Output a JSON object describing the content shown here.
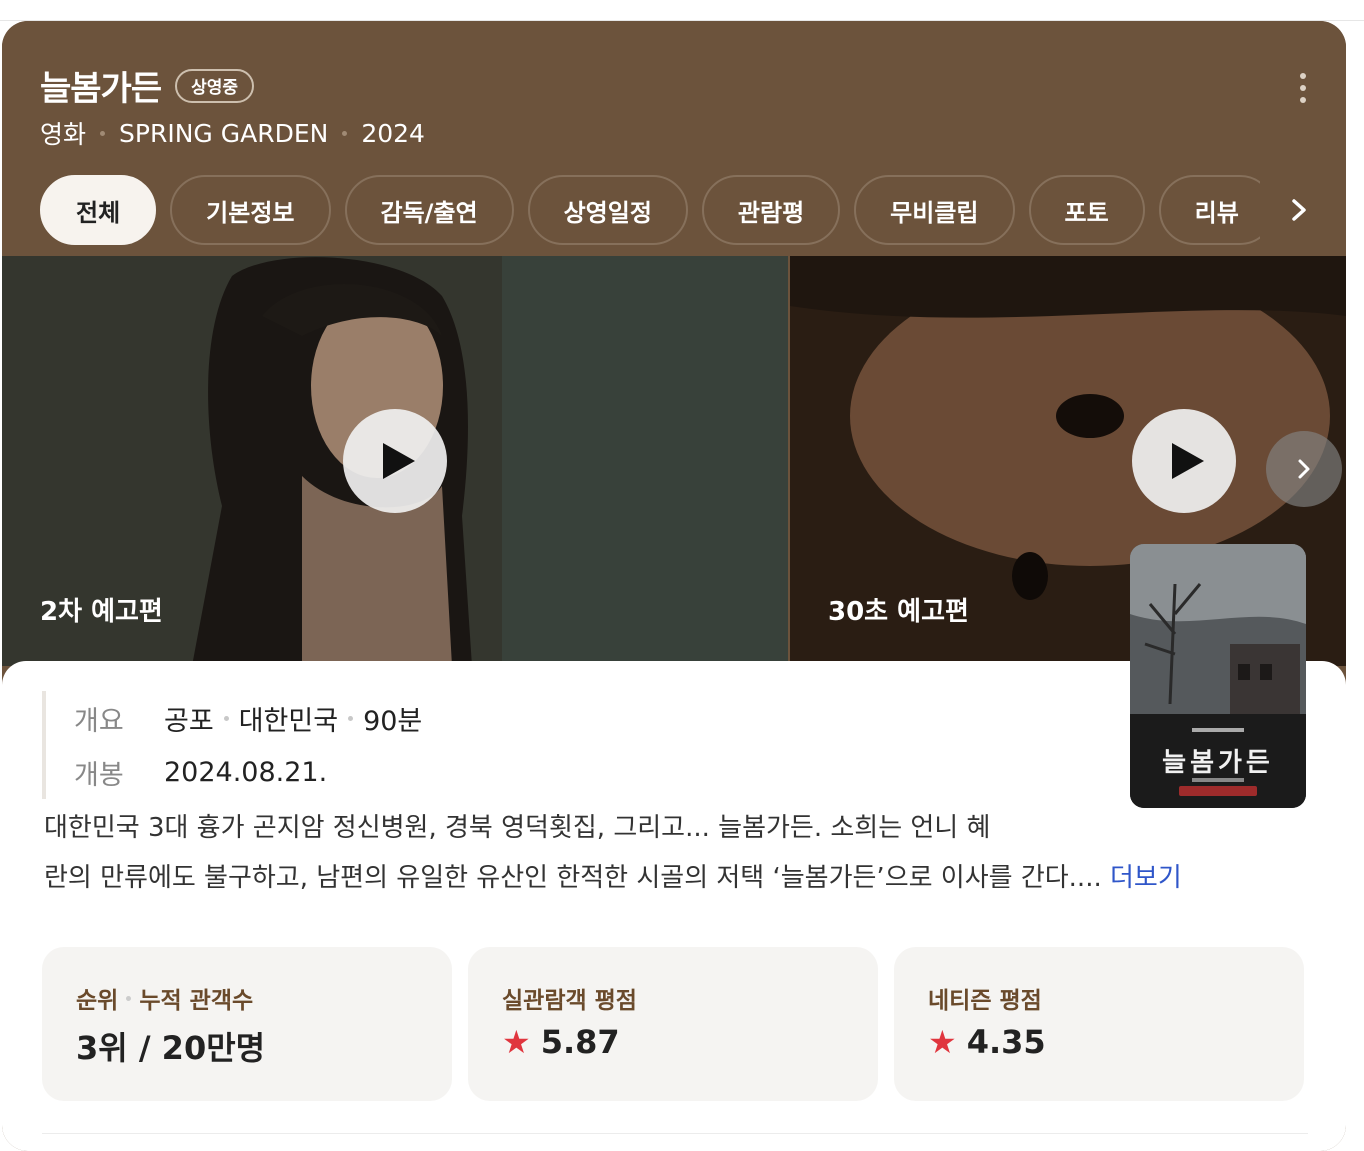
{
  "header": {
    "title": "늘봄가든",
    "badge": "상영중",
    "meta": [
      "영화",
      "SPRING GARDEN",
      "2024"
    ]
  },
  "tabs": [
    {
      "label": "전체",
      "active": true
    },
    {
      "label": "기본정보"
    },
    {
      "label": "감독/출연"
    },
    {
      "label": "상영일정"
    },
    {
      "label": "관람평"
    },
    {
      "label": "무비클립"
    },
    {
      "label": "포토"
    },
    {
      "label": "리뷰"
    }
  ],
  "videos": [
    {
      "label": "2차 예고편"
    },
    {
      "label": "30초 예고편"
    }
  ],
  "facts": {
    "overview_key": "개요",
    "genre": "공포",
    "country": "대한민국",
    "runtime": "90분",
    "release_key": "개봉",
    "release_date": "2024.08.21."
  },
  "synopsis": {
    "line1": "대한민국 3대 흉가 곤지암 정신병원, 경북 영덕횟집, 그리고... 늘봄가든. 소희는 언니 혜",
    "line2": "란의 만류에도 불구하고, 남편의 유일한 유산인 한적한 시골의 저택 ‘늘봄가든’으로 이사를 간다....",
    "more": "더보기"
  },
  "poster": {
    "title": "늘봄가든"
  },
  "stats": {
    "rank": {
      "label_a": "순위",
      "label_b": "누적 관객수",
      "value": "3위 / 20만명"
    },
    "audience": {
      "label": "실관람객 평점",
      "value": "5.87"
    },
    "netizen": {
      "label": "네티즌 평점",
      "value": "4.35"
    }
  },
  "colors": {
    "header_bg": "#6c533c",
    "accent_link": "#2f56c9",
    "star": "#e0353e"
  }
}
